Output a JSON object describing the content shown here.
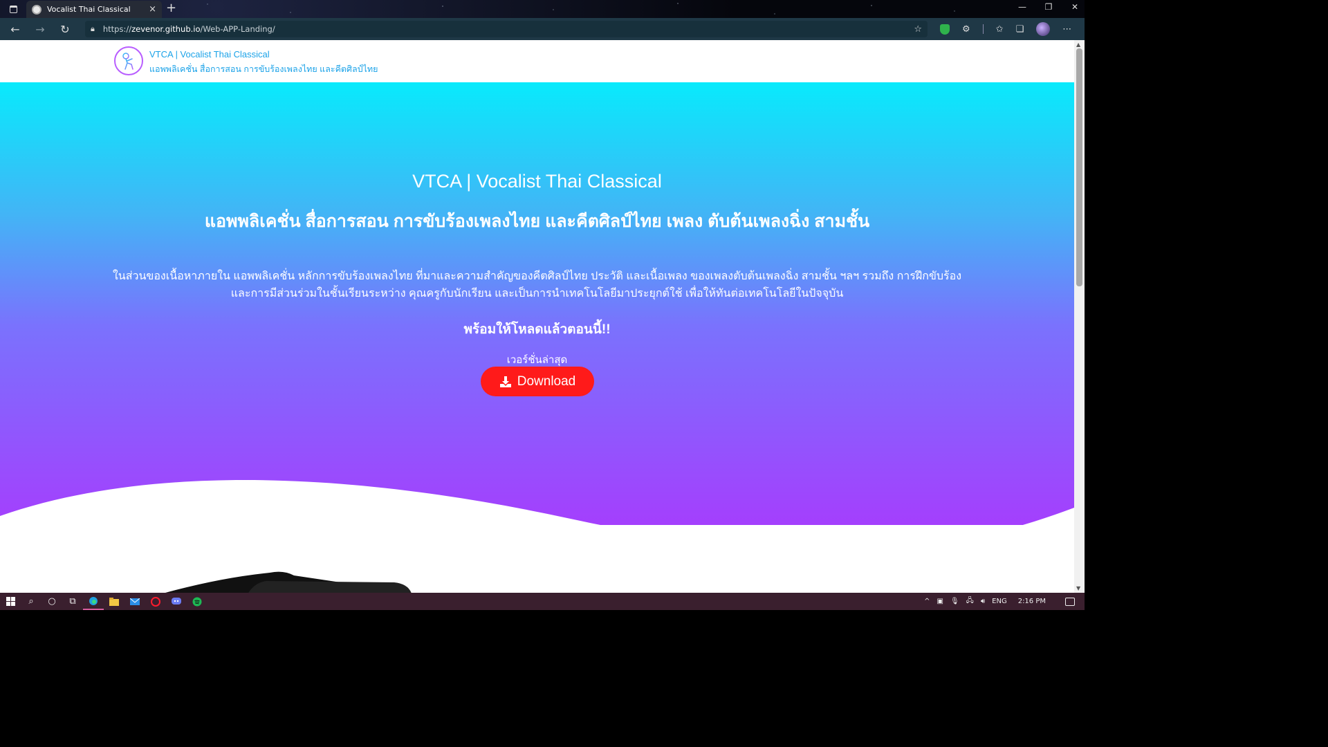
{
  "browser": {
    "tab_title": "Vocalist Thai Classical",
    "tab_close": "×",
    "new_tab": "+",
    "url_prefix": "https://",
    "url_host": "zevenor.github.io",
    "url_path": "/Web-APP-Landing/"
  },
  "site": {
    "brand_title": "VTCA | Vocalist Thai Classical",
    "brand_subtitle": "แอพพลิเคชั่น สื่อการสอน การขับร้องเพลงไทย และคีตศิลป์ไทย"
  },
  "hero": {
    "title": "VTCA | Vocalist Thai Classical",
    "subtitle": "แอพพลิเคชั่น สื่อการสอน การขับร้องเพลงไทย และคีตศิลป์ไทย เพลง ตับต้นเพลงฉิ่ง สามชั้น",
    "description": "ในส่วนของเนื้อหาภายใน แอพพลิเคชั่น หลักการขับร้องเพลงไทย ที่มาและความสำคัญของคีตศิลป์ไทย ประวัติ และเนื้อเพลง ของเพลงตับต้นเพลงฉิ่ง สามชั้น ฯลฯ รวมถึง การฝึกขับร้อง และการมีส่วนร่วมในชั้นเรียนระหว่าง คุณครูกับนักเรียน และเป็นการนำเทคโนโลยีมาประยุกต์ใช้ เพื่อให้ทันต่อเทคโนโลยีในปัจจุบัน",
    "ready_text": "พร้อมให้โหลดแล้วตอนนี้!!",
    "version_label": "เวอร์ชั่นล่าสุด",
    "download_label": "Download",
    "gradient_top": "#08eafc",
    "gradient_bottom": "#a43ffd",
    "button_color": "#ff1a1a"
  },
  "taskbar": {
    "language": "ENG",
    "time": "2:16 PM"
  }
}
